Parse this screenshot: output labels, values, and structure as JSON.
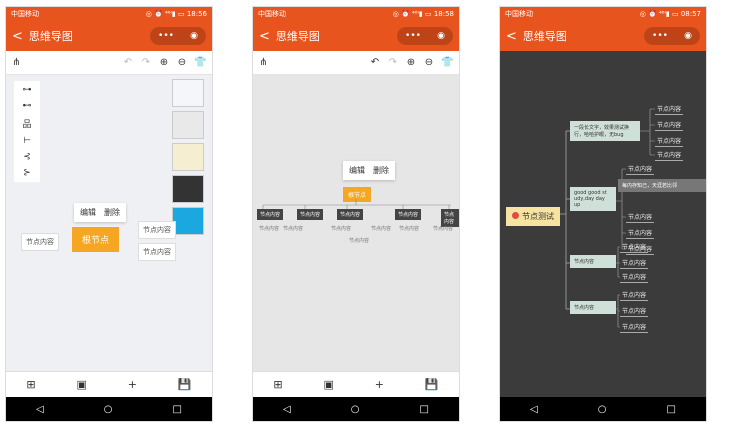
{
  "status": {
    "carrier": "中国移动",
    "icons": "◎ ⏰ ⁴⁶ᴵ▮ ▭",
    "times": [
      "18:56",
      "18:58",
      "08:57"
    ]
  },
  "app": {
    "title": "思维导图",
    "back": "<",
    "more": "•••",
    "target": "◉"
  },
  "toolbar": {
    "undo": "↶",
    "redo": "↷",
    "zoom_in": "⊕",
    "zoom_out": "⊖",
    "theme": "👕"
  },
  "bottombar": {
    "layout": "⊞",
    "image": "▣",
    "add": "+",
    "save": "💾"
  },
  "navbar": {
    "back": "◁",
    "home": "○",
    "recent": "□"
  },
  "menu": {
    "edit": "编辑",
    "delete": "删除"
  },
  "phone1": {
    "root": "根节点",
    "left": "节点内容",
    "right1": "节点内容",
    "right2": "节点内容"
  },
  "phone2": {
    "root": "根节点",
    "child": "节点内容"
  },
  "phone3": {
    "root": "节点测试",
    "branch1": "一段长文字，效果测试换行，哈哈护眼，无bug",
    "branch2": "good good st udy,day day up",
    "branch3": "节点内容",
    "branch4": "节点内容",
    "popup": "每内存知己，天涯若比邻",
    "leaf": "节点内容"
  },
  "colors": {
    "accent": "#e8541e",
    "root": "#f5a623"
  }
}
